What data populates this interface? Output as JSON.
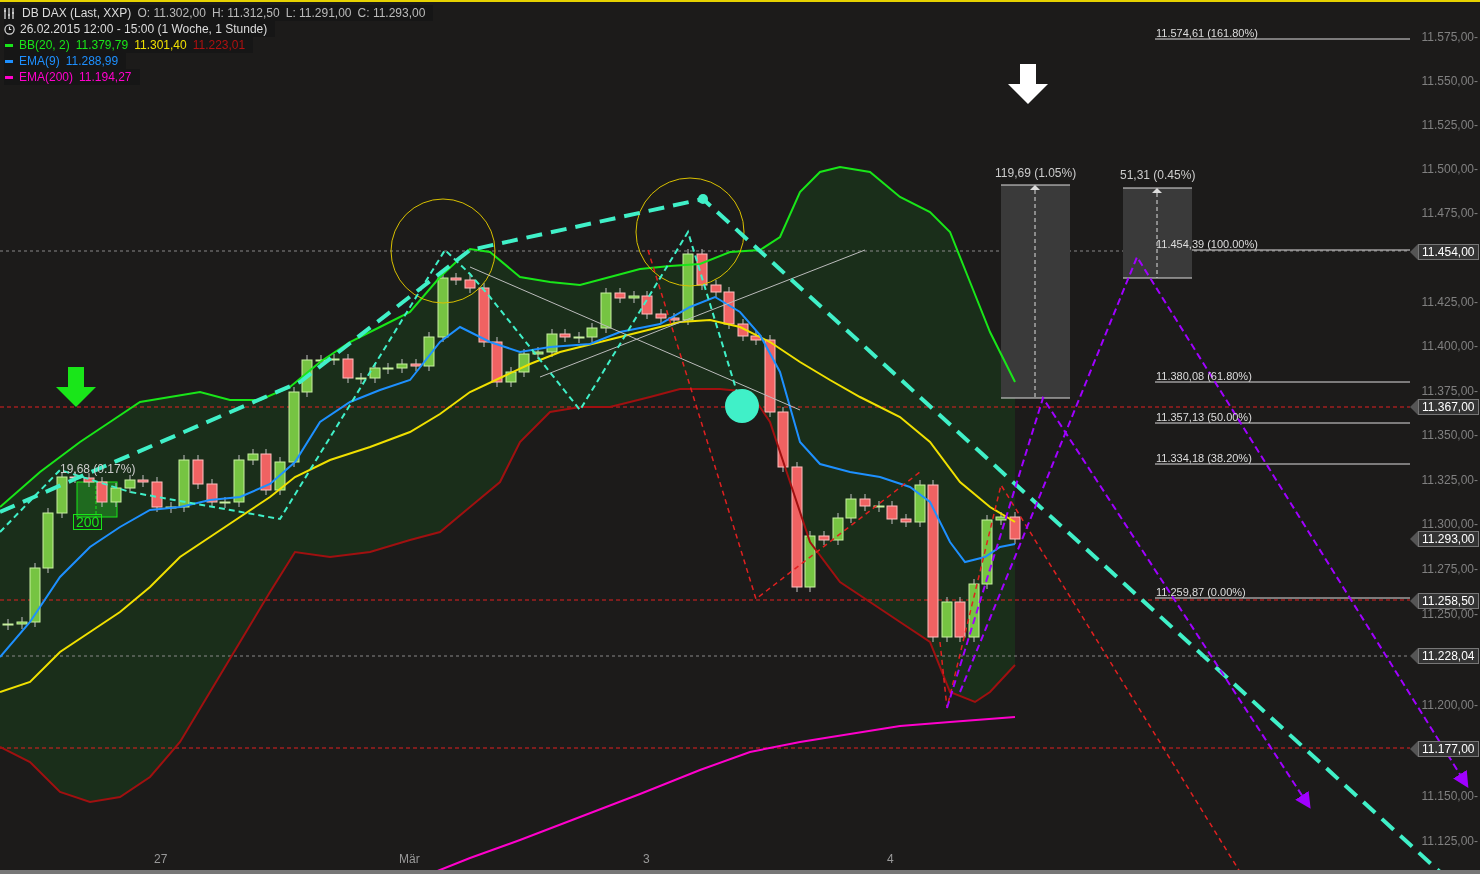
{
  "header": {
    "symbol": "DB DAX (Last, XXP)",
    "ohlc": [
      "O: 11.302,00",
      "H: 11.312,50",
      "L: 11.291,00",
      "C: 11.293,00"
    ],
    "period": "26.02.2015 12:00 - 15:00 (1 Woche, 1 Stunde)"
  },
  "indicators": [
    {
      "name": "BB(20, 2)",
      "color": "#19e619",
      "values": [
        {
          "text": "11.379,79",
          "color": "#19e619"
        },
        {
          "text": "11.301,40",
          "color": "#f0e000"
        },
        {
          "text": "11.223,01",
          "color": "#b01010"
        }
      ]
    },
    {
      "name": "EMA(9)",
      "color": "#1e90ff",
      "values": [
        {
          "text": "11.288,99",
          "color": "#1e90ff"
        }
      ]
    },
    {
      "name": "EMA(200)",
      "color": "#ff00cc",
      "values": [
        {
          "text": "11.194,27",
          "color": "#ff00cc"
        }
      ]
    }
  ],
  "y_axis": [
    "11.575,00-",
    "11.550,00-",
    "11.525,00-",
    "11.500,00-",
    "11.475,00-",
    "11.425,00-",
    "11.400,00-",
    "11.375,00-",
    "11.350,00-",
    "11.325,00-",
    "11.300,00-",
    "11.275,00-",
    "11.250,00-",
    "11.200,00-",
    "11.150,00-",
    "11.125,00-"
  ],
  "price_tags": [
    "11.454,00",
    "11.367,00",
    "11.293,00",
    "11.258,50",
    "11.228,04",
    "11.177,00"
  ],
  "fib_levels": [
    "11.574,61 (161.80%)",
    "11.454,39 (100.00%)",
    "11.380,08 (61.80%)",
    "11.357,13 (50.00%)",
    "11.334,18 (38.20%)",
    "11.259,87 (0.00%)"
  ],
  "measures": [
    "19,68 (0.17%)",
    "119,69 (1.05%)",
    "51,31 (0.45%)"
  ],
  "period_label": "200",
  "x_axis": [
    "27",
    "Mär",
    "3",
    "4"
  ]
}
